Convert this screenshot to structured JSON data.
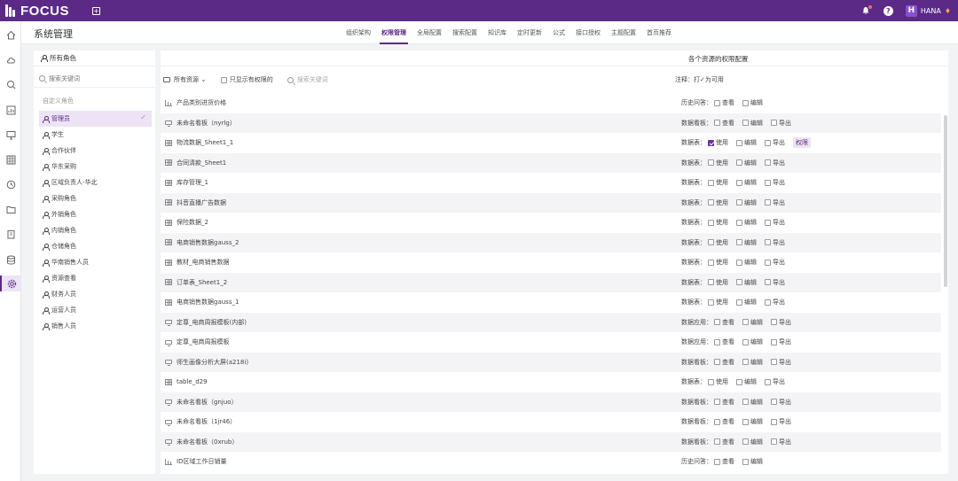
{
  "topbar": {
    "logo_text": "FOCUS",
    "add_symbol": "+",
    "user_initial": "H",
    "user_name": "HANA",
    "help_symbol": "?"
  },
  "sidenav": {
    "icons": [
      "home-icon",
      "cloud-icon",
      "search-icon",
      "chart-icon",
      "monitor-icon",
      "table-icon",
      "clock-icon",
      "folder-icon",
      "clipboard-icon",
      "database-icon",
      "settings-icon"
    ],
    "active_index": 10
  },
  "header": {
    "title": "系统管理",
    "tabs": [
      {
        "label": "组织架构"
      },
      {
        "label": "权限管理"
      },
      {
        "label": "全局配置"
      },
      {
        "label": "搜索配置"
      },
      {
        "label": "知识库"
      },
      {
        "label": "定时更新"
      },
      {
        "label": "公式"
      },
      {
        "label": "接口授权"
      },
      {
        "label": "主题配置"
      },
      {
        "label": "首页推荐"
      }
    ],
    "active_tab": 1
  },
  "roles_panel": {
    "title": "所有角色",
    "search_placeholder": "搜索关键词",
    "group_label": "自定义角色",
    "roles": [
      {
        "label": "管理员",
        "active": true
      },
      {
        "label": "学生"
      },
      {
        "label": "合作伙伴"
      },
      {
        "label": "华东采购"
      },
      {
        "label": "区域负责人-华北"
      },
      {
        "label": "采购角色"
      },
      {
        "label": "外销角色"
      },
      {
        "label": "内销角色"
      },
      {
        "label": "仓储角色"
      },
      {
        "label": "华南销售人员"
      },
      {
        "label": "资源查看"
      },
      {
        "label": "财务人员"
      },
      {
        "label": "运营人员"
      },
      {
        "label": "销售人员"
      }
    ],
    "check_symbol": "✓"
  },
  "resources_panel": {
    "title": "各个资源的权限配置",
    "filter_label": "所有资源",
    "only_perm_label": "只显示有权限的",
    "search_placeholder": "搜索关键词",
    "note": "注释：打✓为可用",
    "tag_label": "权限",
    "rows": [
      {
        "icon": "chart",
        "name": "产品类别进货价格",
        "type": "历史问答：",
        "perms": [
          {
            "label": "查看",
            "on": false
          },
          {
            "label": "编辑",
            "on": false
          }
        ]
      },
      {
        "icon": "monitor",
        "name": "未命名看板（nyrlg）",
        "type": "数据看板：",
        "perms": [
          {
            "label": "查看",
            "on": false
          },
          {
            "label": "编辑",
            "on": false
          },
          {
            "label": "导出",
            "on": false
          }
        ]
      },
      {
        "icon": "grid",
        "name": "物流数据_Sheet1_1",
        "type": "数据表：",
        "perms": [
          {
            "label": "使用",
            "on": true
          },
          {
            "label": "编辑",
            "on": false
          },
          {
            "label": "导出",
            "on": false
          }
        ],
        "tag": true
      },
      {
        "icon": "grid",
        "name": "合同清款_Sheet1",
        "type": "数据表：",
        "perms": [
          {
            "label": "使用",
            "on": false
          },
          {
            "label": "编辑",
            "on": false
          },
          {
            "label": "导出",
            "on": false
          }
        ]
      },
      {
        "icon": "grid",
        "name": "库存管理_1",
        "type": "数据表：",
        "perms": [
          {
            "label": "使用",
            "on": false
          },
          {
            "label": "编辑",
            "on": false
          },
          {
            "label": "导出",
            "on": false
          }
        ]
      },
      {
        "icon": "grid",
        "name": "抖音直播广告数据",
        "type": "数据表：",
        "perms": [
          {
            "label": "使用",
            "on": false
          },
          {
            "label": "编辑",
            "on": false
          },
          {
            "label": "导出",
            "on": false
          }
        ]
      },
      {
        "icon": "grid",
        "name": "保险数据_2",
        "type": "数据表：",
        "perms": [
          {
            "label": "使用",
            "on": false
          },
          {
            "label": "编辑",
            "on": false
          },
          {
            "label": "导出",
            "on": false
          }
        ]
      },
      {
        "icon": "grid",
        "name": "电商销售数据gauss_2",
        "type": "数据表：",
        "perms": [
          {
            "label": "使用",
            "on": false
          },
          {
            "label": "编辑",
            "on": false
          },
          {
            "label": "导出",
            "on": false
          }
        ]
      },
      {
        "icon": "grid",
        "name": "教材_电商销售数据",
        "type": "数据表：",
        "perms": [
          {
            "label": "使用",
            "on": false
          },
          {
            "label": "编辑",
            "on": false
          },
          {
            "label": "导出",
            "on": false
          }
        ]
      },
      {
        "icon": "grid",
        "name": "订单表_Sheet1_2",
        "type": "数据表：",
        "perms": [
          {
            "label": "使用",
            "on": false
          },
          {
            "label": "编辑",
            "on": false
          },
          {
            "label": "导出",
            "on": false
          }
        ]
      },
      {
        "icon": "grid",
        "name": "电商销售数据gauss_1",
        "type": "数据表：",
        "perms": [
          {
            "label": "使用",
            "on": false
          },
          {
            "label": "编辑",
            "on": false
          },
          {
            "label": "导出",
            "on": false
          }
        ]
      },
      {
        "icon": "monitor",
        "name": "定尊_电商周报模板(内部)",
        "type": "数据应用：",
        "perms": [
          {
            "label": "查看",
            "on": false
          },
          {
            "label": "编辑",
            "on": false
          },
          {
            "label": "导出",
            "on": false
          }
        ]
      },
      {
        "icon": "monitor",
        "name": "定尊_电商周报模板",
        "type": "数据应用：",
        "perms": [
          {
            "label": "查看",
            "on": false
          },
          {
            "label": "编辑",
            "on": false
          },
          {
            "label": "导出",
            "on": false
          }
        ]
      },
      {
        "icon": "monitor",
        "name": "师生画像分析大屏(a218i)",
        "type": "数据看板：",
        "perms": [
          {
            "label": "查看",
            "on": false
          },
          {
            "label": "编辑",
            "on": false
          },
          {
            "label": "导出",
            "on": false
          }
        ]
      },
      {
        "icon": "grid",
        "name": "table_d29",
        "type": "数据表：",
        "perms": [
          {
            "label": "使用",
            "on": false
          },
          {
            "label": "编辑",
            "on": false
          },
          {
            "label": "导出",
            "on": false
          }
        ]
      },
      {
        "icon": "monitor",
        "name": "未命名看板（gnjuo）",
        "type": "数据看板：",
        "perms": [
          {
            "label": "查看",
            "on": false
          },
          {
            "label": "编辑",
            "on": false
          },
          {
            "label": "导出",
            "on": false
          }
        ]
      },
      {
        "icon": "monitor",
        "name": "未命名看板（1jr46）",
        "type": "数据看板：",
        "perms": [
          {
            "label": "查看",
            "on": false
          },
          {
            "label": "编辑",
            "on": false
          },
          {
            "label": "导出",
            "on": false
          }
        ]
      },
      {
        "icon": "monitor",
        "name": "未命名看板（0xrub）",
        "type": "数据看板：",
        "perms": [
          {
            "label": "查看",
            "on": false
          },
          {
            "label": "编辑",
            "on": false
          },
          {
            "label": "导出",
            "on": false
          }
        ]
      },
      {
        "icon": "chart",
        "name": "ID区域工作日销量",
        "type": "历史问答：",
        "perms": [
          {
            "label": "查看",
            "on": false
          },
          {
            "label": "编辑",
            "on": false
          }
        ]
      }
    ]
  }
}
